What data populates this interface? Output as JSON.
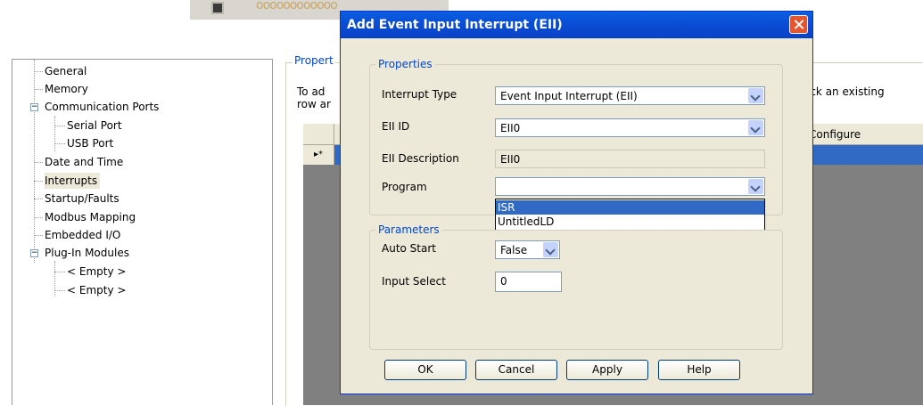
{
  "top_strip": {
    "chain_text": "oooooooooooo"
  },
  "tree": {
    "items": [
      {
        "label": "General"
      },
      {
        "label": "Memory"
      },
      {
        "label": "Communication Ports"
      },
      {
        "label": "Serial Port"
      },
      {
        "label": "USB Port"
      },
      {
        "label": "Date and Time"
      },
      {
        "label": "Interrupts"
      },
      {
        "label": "Startup/Faults"
      },
      {
        "label": "Modbus Mapping"
      },
      {
        "label": "Embedded I/O"
      },
      {
        "label": "Plug-In Modules"
      },
      {
        "label": "< Empty >"
      },
      {
        "label": "< Empty >"
      }
    ],
    "expander_minus": "−"
  },
  "properties": {
    "legend": "Propert",
    "text_line1": "To ad",
    "text_line2": "row ar",
    "text_right": "ick an existing",
    "grid_header_configure": "Configure",
    "row_marker": "▸*"
  },
  "dialog": {
    "title": "Add Event Input Interrupt (EII)",
    "properties_group": {
      "legend": "Properties",
      "interrupt_type_label": "Interrupt Type",
      "interrupt_type_value": "Event Input Interrupt (EII)",
      "eii_id_label": "EII ID",
      "eii_id_value": "EII0",
      "eii_description_label": "EII Description",
      "eii_description_value": "EII0",
      "program_label": "Program",
      "program_value": "",
      "program_options": [
        "ISR",
        "UntitledLD"
      ],
      "program_highlighted": "ISR"
    },
    "parameters_group": {
      "legend": "Parameters",
      "auto_start_label": "Auto Start",
      "auto_start_value": "False",
      "input_select_label": "Input Select",
      "input_select_value": "0"
    },
    "buttons": {
      "ok": "OK",
      "cancel": "Cancel",
      "apply": "Apply",
      "help": "Help"
    }
  }
}
